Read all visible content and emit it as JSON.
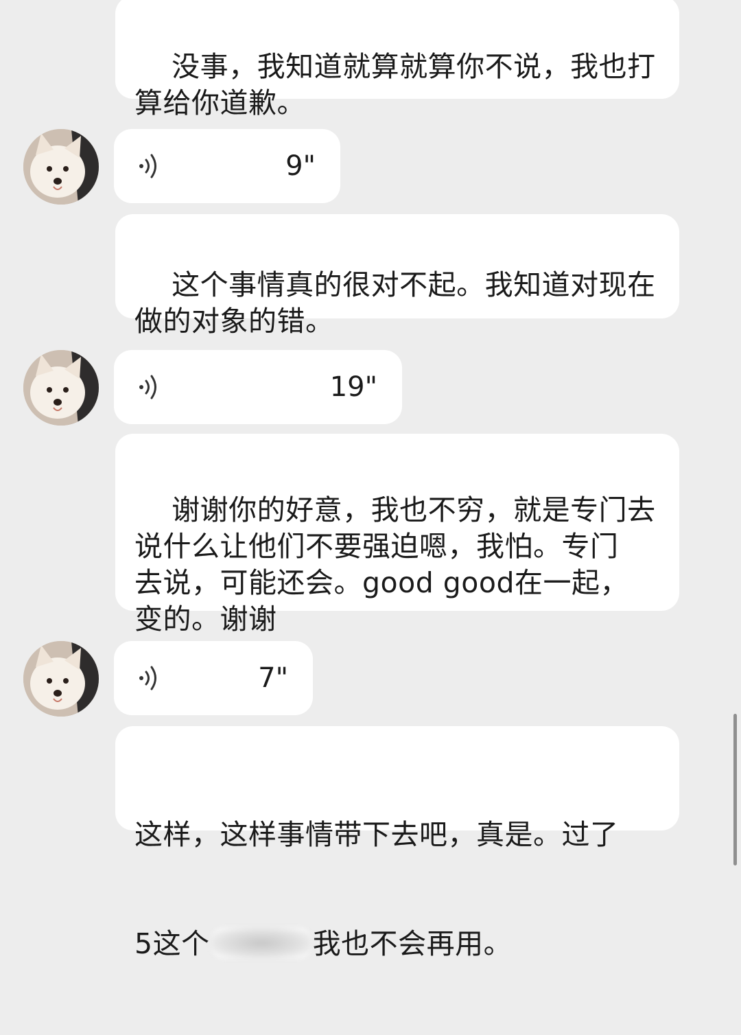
{
  "messages": [
    {
      "type": "text",
      "text": "没事，我知道就算就算你不说，我也打\n算给你道歉。"
    },
    {
      "type": "voice",
      "duration": "9\""
    },
    {
      "type": "text",
      "text": "这个事情真的很对不起。我知道对现在\n做的对象的错。"
    },
    {
      "type": "voice",
      "duration": "19\""
    },
    {
      "type": "text",
      "text": "谢谢你的好意，我也不穷，就是专门去\n说什么让他们不要强迫嗯，我怕。专门\n去说，可能还会。good good在一起，\n变的。谢谢"
    },
    {
      "type": "voice",
      "duration": "7\""
    },
    {
      "type": "text",
      "line1": "这样，这样事情带下去吧，真是。过了",
      "line2_start": "5这个",
      "line2_end": "我也不会再用。"
    }
  ],
  "icons": {
    "avatar": "white-puppy-avatar",
    "voice": "voice-wave-icon"
  },
  "colors": {
    "background": "#ededed",
    "bubble": "#ffffff",
    "text": "#1a1a1a"
  }
}
